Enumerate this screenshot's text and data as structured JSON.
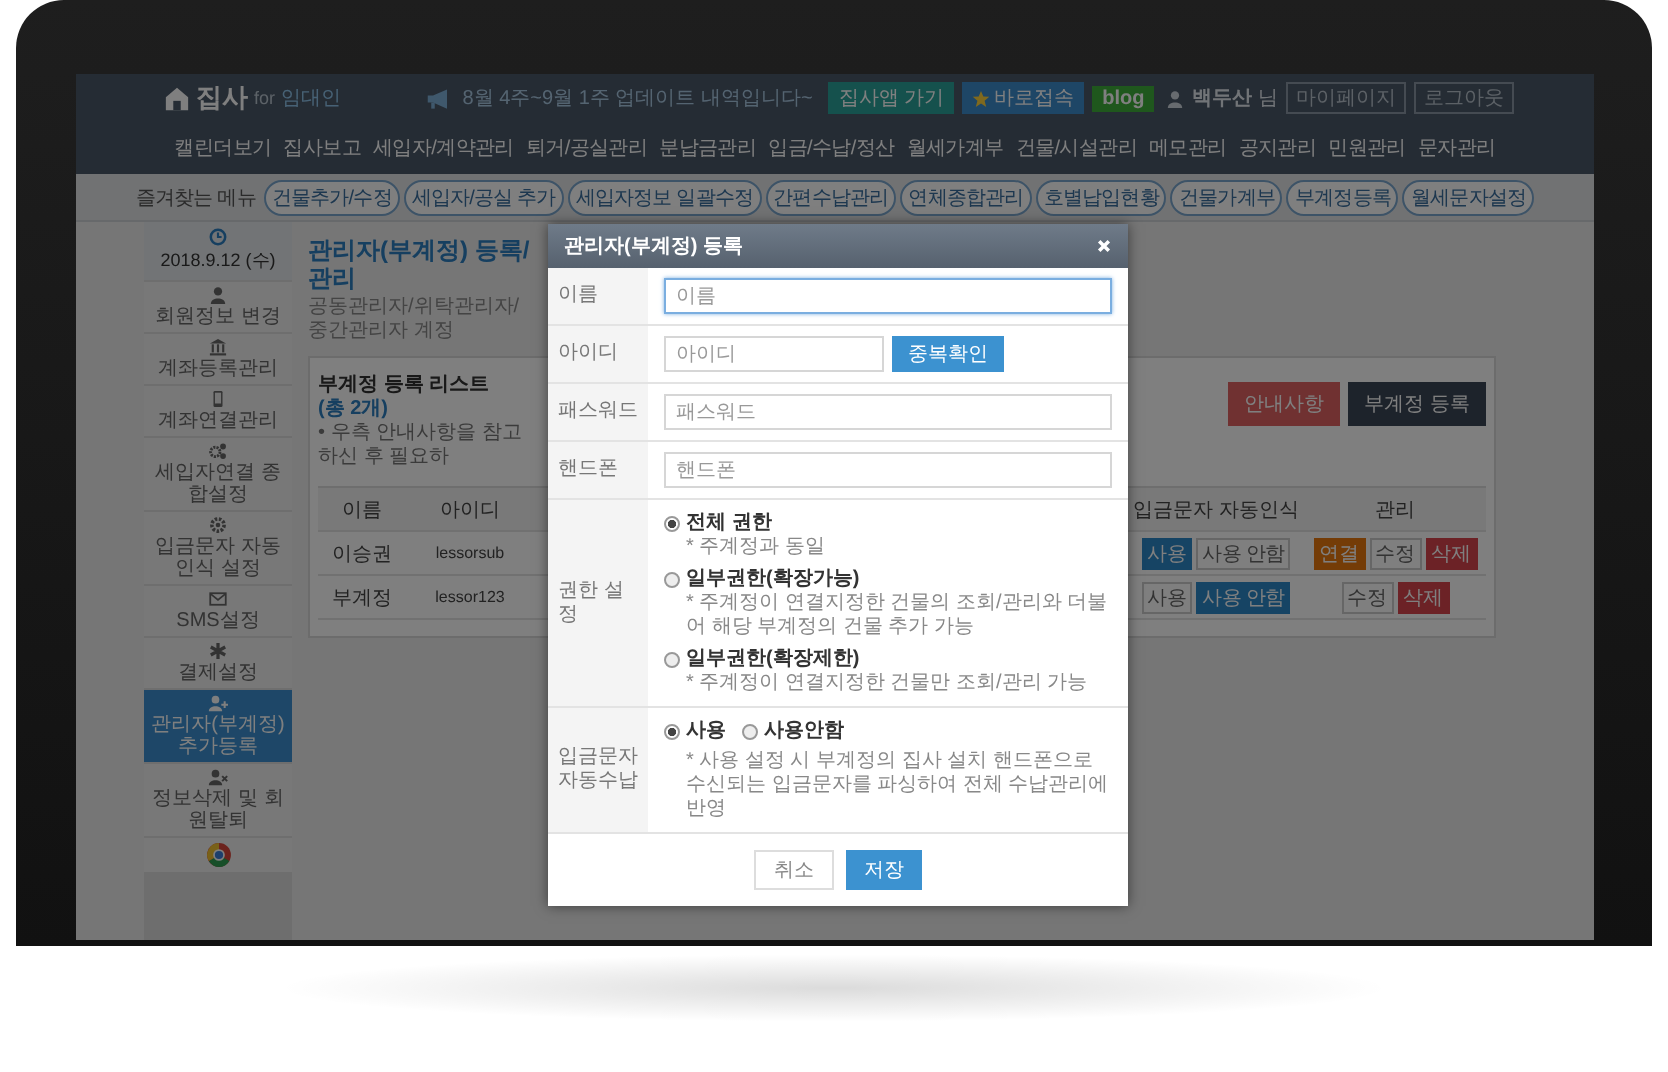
{
  "header": {
    "logo": "집사",
    "logo_for": "for",
    "logo_sub": "임대인",
    "notice": "8월 4주~9월 1주 업데이트 내역입니다~",
    "buttons": [
      {
        "label": "집사앱 가기",
        "kind": "app"
      },
      {
        "label": "바로접속",
        "kind": "shortcut"
      },
      {
        "label": "blog",
        "kind": "blog"
      }
    ],
    "user": "**백두산** 님",
    "links": [
      "마이페이지",
      "로그아웃"
    ]
  },
  "nav": [
    "캘린더보기",
    "집사보고",
    "세입자/계약관리",
    "퇴거/공실관리",
    "분납금관리",
    "입금/수납/정산",
    "월세가계부",
    "건물/시설관리",
    "메모관리",
    "공지관리",
    "민원관리",
    "문자관리"
  ],
  "favorites": {
    "label": "즐겨찾는 메뉴",
    "items": [
      "건물추가/수정",
      "세입자/공실 추가",
      "세입자정보 일괄수정",
      "간편수납관리",
      "연체종합관리",
      "호별납입현황",
      "건물가계부",
      "부계정등록",
      "월세문자설정"
    ]
  },
  "sidebar": {
    "date": "2018.9.12 (수)",
    "items": [
      {
        "label": "회원정보 변경",
        "kind": "user",
        "selected": false
      },
      {
        "label": "계좌등록관리",
        "kind": "bank",
        "selected": false
      },
      {
        "label": "계좌연결관리",
        "kind": "phone",
        "selected": false
      },
      {
        "label": "세입자연결 종합설정",
        "kind": "gears",
        "selected": false
      },
      {
        "label": "입금문자 자동인식 설정",
        "kind": "gear",
        "selected": false
      },
      {
        "label": "SMS설정",
        "kind": "mail",
        "selected": false
      },
      {
        "label": "결제설정",
        "kind": "asterisk",
        "selected": false
      },
      {
        "label": "관리자(부계정) 추가등록",
        "kind": "user-add",
        "selected": true
      },
      {
        "label": "정보삭제 및 회원탈퇴",
        "kind": "user-remove",
        "selected": false
      },
      {
        "kind": "browser",
        "selected": false
      }
    ]
  },
  "page": {
    "title": "관리자(부계정) 등록/관리",
    "description": "공동관리자/위탁관리자/중간관리자 계정"
  },
  "list": {
    "title": "부계정 등록 리스트",
    "count": "(총 2개)",
    "note": "• 우측 안내사항을 참고하신 후 필요하",
    "buttons": [
      {
        "label": "안내사항",
        "kind": "guide"
      },
      {
        "label": "부계정 등록",
        "kind": "add"
      }
    ],
    "columns": [
      "이름",
      "아이디",
      "입금문자 자동인식",
      "관리"
    ],
    "rows": [
      {
        "name": "이승권",
        "id": "lessorsub",
        "auto": [
          {
            "label": "사용",
            "selected": true
          },
          {
            "label": "사용 안함",
            "selected": false
          }
        ],
        "actions": [
          {
            "label": "연결",
            "kind": "connect"
          },
          {
            "label": "수정",
            "kind": "edit"
          },
          {
            "label": "삭제",
            "kind": "delete"
          }
        ]
      },
      {
        "name": "부계정",
        "id": "lessor123",
        "auto": [
          {
            "label": "사용",
            "selected": false
          },
          {
            "label": "사용 안함",
            "selected": true
          }
        ],
        "actions": [
          {
            "label": "수정",
            "kind": "edit"
          },
          {
            "label": "삭제",
            "kind": "delete"
          }
        ]
      }
    ]
  },
  "modal": {
    "title": "관리자(부계정) 등록",
    "fields": [
      {
        "label": "이름",
        "placeholder": "이름",
        "focused": true
      },
      {
        "label": "아이디",
        "placeholder": "아이디",
        "focused": false,
        "button": "중복확인"
      },
      {
        "label": "패스워드",
        "placeholder": "패스워드",
        "focused": false
      },
      {
        "label": "핸드폰",
        "placeholder": "핸드폰",
        "focused": false
      }
    ],
    "permission": {
      "label": "권한 설정",
      "options": [
        {
          "label": "전체 권한",
          "note": "* 주계정과 동일",
          "selected": true
        },
        {
          "label": "일부권한(확장가능)",
          "note": "* 주계정이 연결지정한 건물의 조회/관리와 더불어 해당 부계정의 건물 추가 가능",
          "selected": false
        },
        {
          "label": "일부권한(확장제한)",
          "note": "* 주계정이 연결지정한 건물만 조회/관리 가능",
          "selected": false
        }
      ]
    },
    "auto_collect": {
      "label": "입금문자 자동수납",
      "options": [
        {
          "label": "사용",
          "selected": true
        },
        {
          "label": "사용안함",
          "selected": false
        }
      ],
      "note": "* 사용 설정 시 부계정의 집사 설치 핸드폰으로 수신되는 입금문자를 파싱하여 전체 수납관리에 반영"
    },
    "buttons": [
      {
        "label": "취소",
        "kind": "cancel"
      },
      {
        "label": "저장",
        "kind": "save"
      }
    ]
  }
}
